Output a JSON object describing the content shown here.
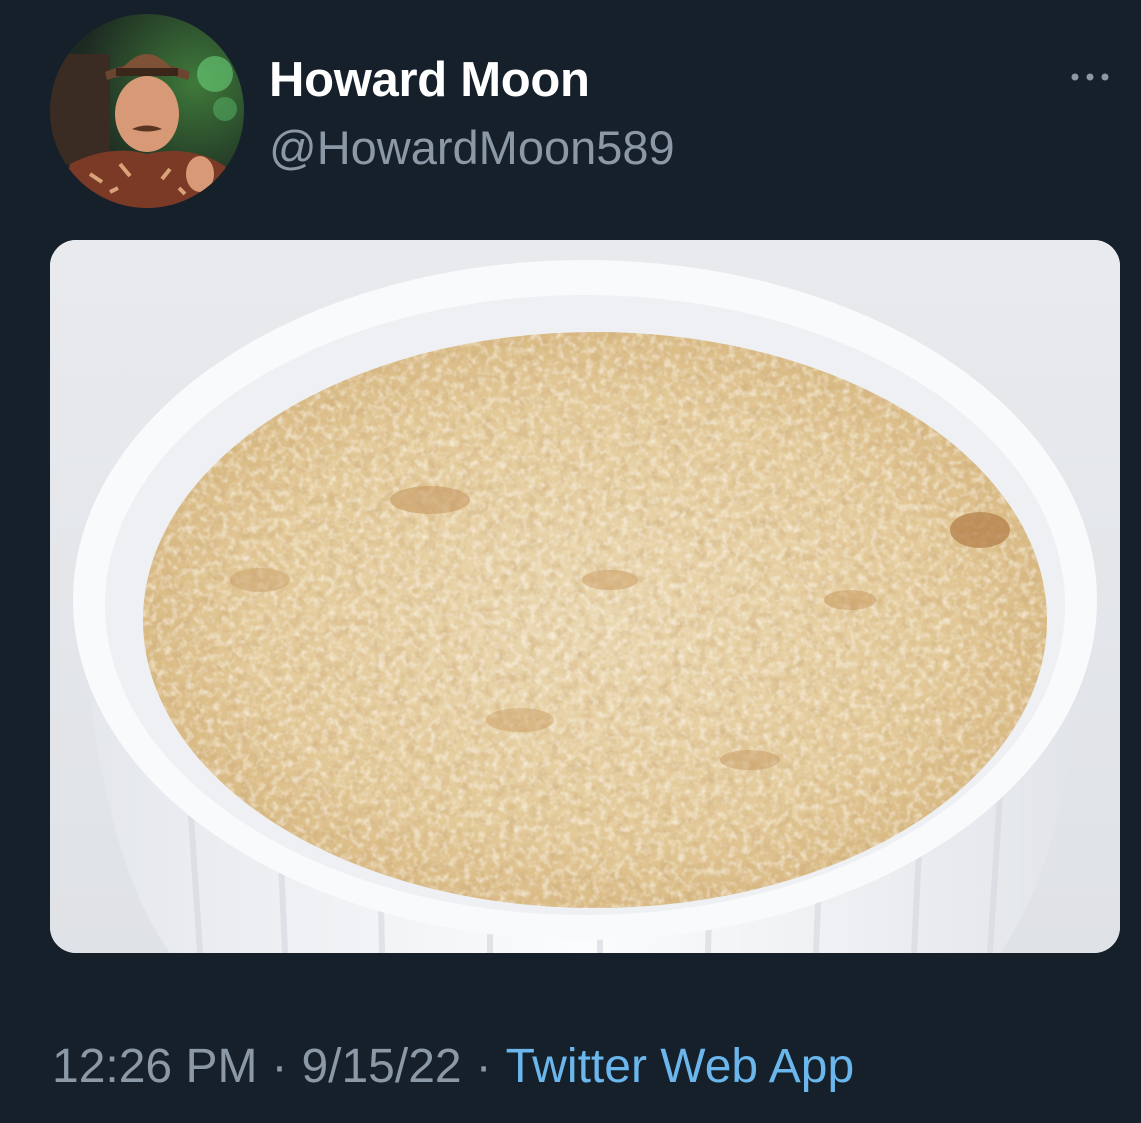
{
  "user": {
    "display_name": "Howard Moon",
    "handle": "@HowardMoon589"
  },
  "tweet": {
    "time": "12:26 PM",
    "separator": "·",
    "date": "9/15/22",
    "source": "Twitter Web App"
  },
  "icons": {
    "more": "more-horizontal-icon"
  },
  "colors": {
    "background": "#15202b",
    "display_name": "#ffffff",
    "secondary_text": "#8b98a5",
    "link": "#6bb6ec"
  }
}
